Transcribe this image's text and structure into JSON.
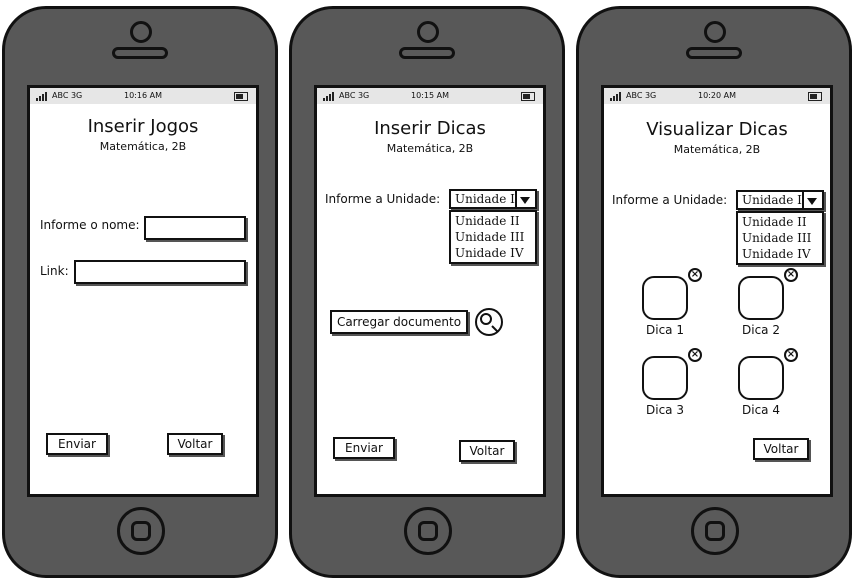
{
  "status_bar": {
    "carrier": "ABC 3G"
  },
  "screens": [
    {
      "time": "10:16 AM",
      "title": "Inserir Jogos",
      "subtitle": "Matemática, 2B",
      "name_label": "Informe o nome:",
      "name_value": "",
      "link_label": "Link:",
      "link_value": "",
      "submit_label": "Enviar",
      "back_label": "Voltar"
    },
    {
      "time": "10:15 AM",
      "title": "Inserir Dicas",
      "subtitle": "Matemática, 2B",
      "unit_label": "Informe a Unidade:",
      "unit_selected": "Unidade I",
      "unit_options": [
        "Unidade II",
        "Unidade III",
        "Unidade IV"
      ],
      "upload_label": "Carregar documento",
      "submit_label": "Enviar",
      "back_label": "Voltar"
    },
    {
      "time": "10:20 AM",
      "title": "Visualizar Dicas",
      "subtitle": "Matemática, 2B",
      "unit_label": "Informe a Unidade:",
      "unit_selected": "Unidade I",
      "unit_options": [
        "Unidade II",
        "Unidade III",
        "Unidade IV"
      ],
      "tips": [
        "Dica 1",
        "Dica 2",
        "Dica 3",
        "Dica 4"
      ],
      "tip_delete_glyph": "×",
      "back_label": "Voltar"
    }
  ]
}
